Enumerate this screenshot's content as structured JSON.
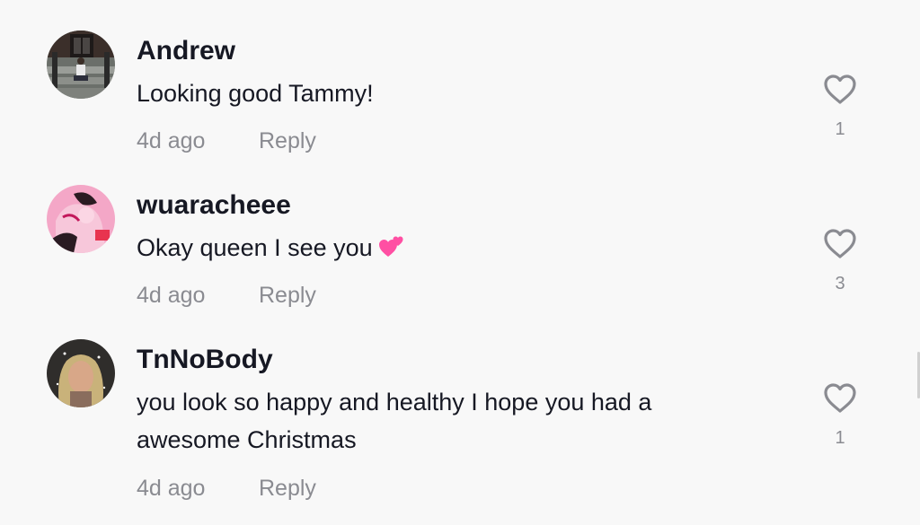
{
  "comments": [
    {
      "username": "Andrew",
      "text": "Looking good Tammy!",
      "time": "4d ago",
      "reply": "Reply",
      "likes": "1",
      "avatar": "photo-stairs-avatar"
    },
    {
      "username": "wuaracheee",
      "text": "Okay queen I see you",
      "emoji": "two-hearts-emoji",
      "time": "4d ago",
      "reply": "Reply",
      "likes": "3",
      "avatar": "pink-illustration-avatar"
    },
    {
      "username": "TnNoBody",
      "text": "you look so happy and healthy I hope you had a awesome Christmas",
      "time": "4d ago",
      "reply": "Reply",
      "likes": "1",
      "avatar": "selfie-avatar"
    }
  ],
  "colors": {
    "background": "#f8f8f8",
    "username": "#161823",
    "meta": "#8a8b91",
    "heart_emoji": "#ff4fa3"
  },
  "icons": {
    "like": "heart-outline-icon"
  }
}
